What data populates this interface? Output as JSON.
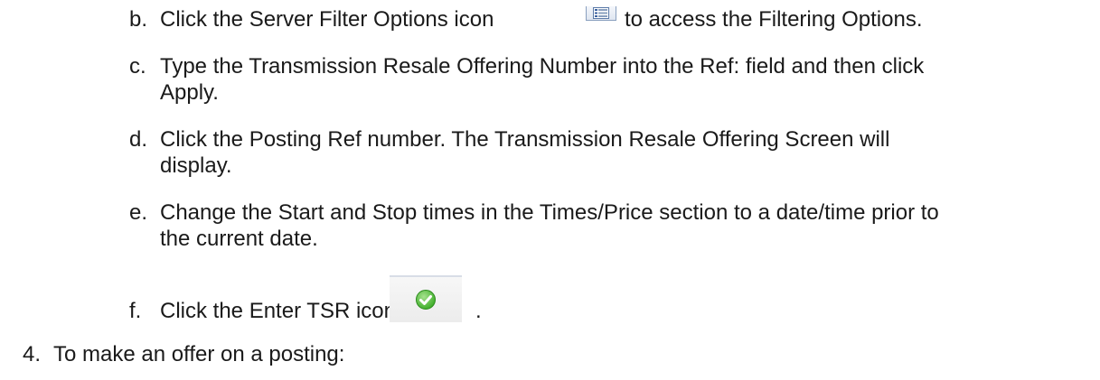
{
  "steps": [
    {
      "marker": "b.",
      "lines": [
        "Click the Server Filter Options icon",
        "to access the Filtering Options."
      ],
      "icon": "filter-options-icon"
    },
    {
      "marker": "c.",
      "lines": [
        "Type the Transmission Resale Offering Number into the Ref: field and then click",
        "Apply."
      ]
    },
    {
      "marker": "d.",
      "lines": [
        "Click the Posting Ref number. The Transmission Resale Offering Screen will",
        "display."
      ]
    },
    {
      "marker": "e.",
      "lines": [
        "Change the Start and Stop times in the Times/Price section to a date/time prior to",
        "the current date."
      ]
    },
    {
      "marker": "f.",
      "lines": [
        "Click the Enter TSR icon",
        "."
      ],
      "icon": "enter-tsr-check-icon"
    }
  ],
  "next_step": {
    "marker": "4.",
    "text": "To make an offer on a posting:"
  },
  "colors": {
    "text": "#1a1a1a",
    "check_green": "#3fae2a"
  }
}
